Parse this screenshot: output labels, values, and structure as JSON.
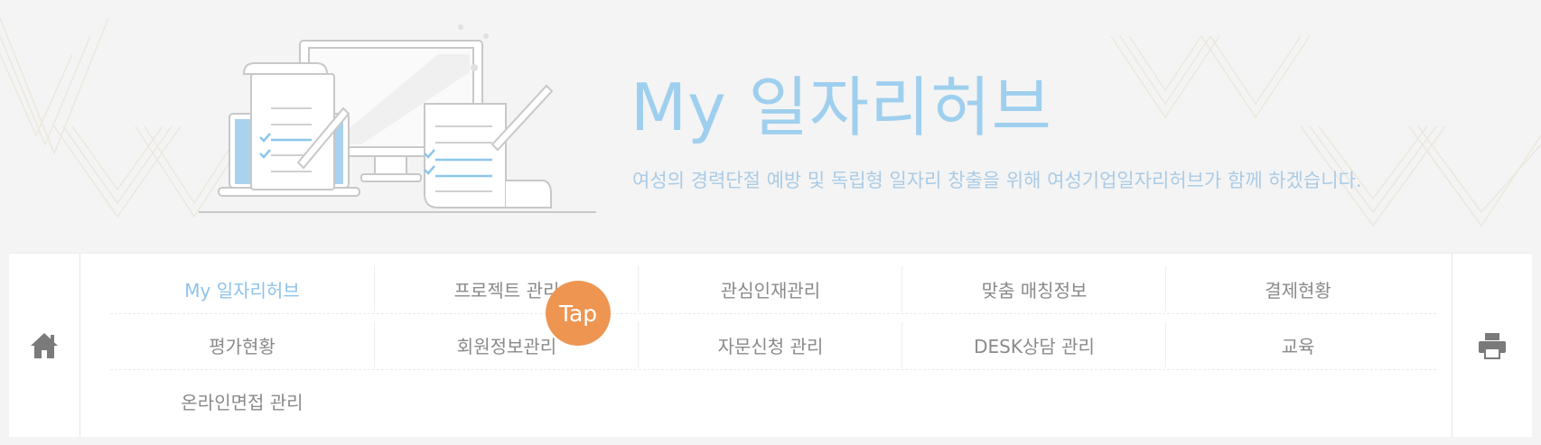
{
  "hero": {
    "title": "My 일자리허브",
    "subtitle": "여성의 경력단절 예방 및 독립형 일자리 창출을 위해 여성기업일자리허브가 함께 하겠습니다."
  },
  "menu": {
    "row1": [
      {
        "label": "My 일자리허브",
        "active": true
      },
      {
        "label": "프로젝트 관리"
      },
      {
        "label": "관심인재관리"
      },
      {
        "label": "맞춤 매칭정보"
      },
      {
        "label": "결제현황"
      }
    ],
    "row2": [
      {
        "label": "평가현황"
      },
      {
        "label": "회원정보관리"
      },
      {
        "label": "자문신청 관리"
      },
      {
        "label": "DESK상담 관리"
      },
      {
        "label": "교육"
      }
    ],
    "row3": [
      {
        "label": "온라인면접 관리"
      }
    ]
  },
  "icons": {
    "home": "home-icon",
    "print": "printer-icon"
  },
  "tap_indicator": "Tap",
  "colors": {
    "accent": "#8fc3ea",
    "tap": "#ee9552",
    "text": "#8a8a8a"
  }
}
